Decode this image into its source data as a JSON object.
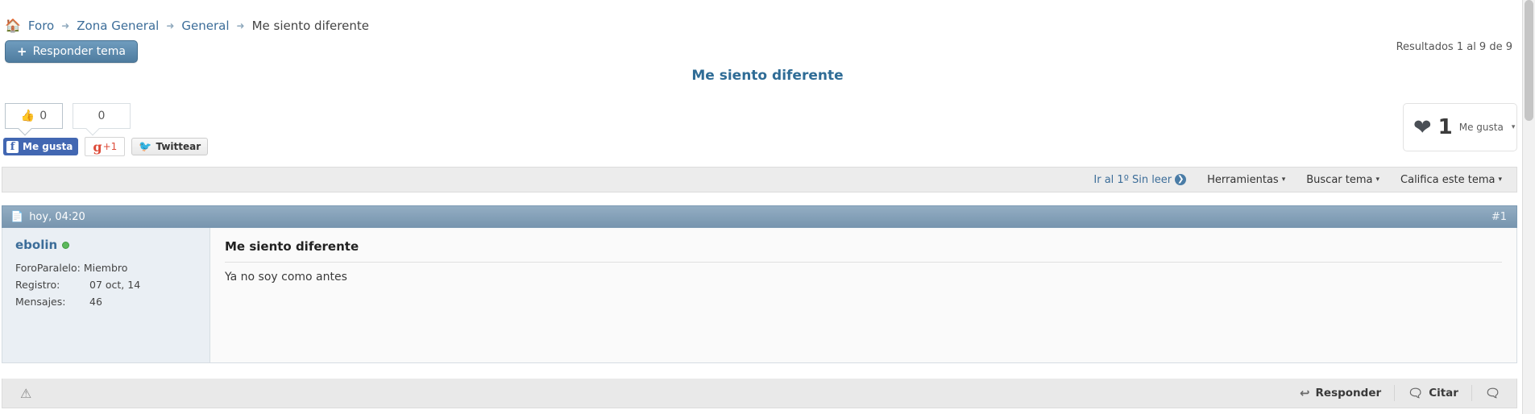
{
  "breadcrumb": {
    "home_icon": "home-icon",
    "items": [
      {
        "label": "Foro",
        "type": "link"
      },
      {
        "label": "Zona General",
        "type": "link"
      },
      {
        "label": "General",
        "type": "link"
      },
      {
        "label": "Me siento diferente",
        "type": "current"
      }
    ],
    "separator": "➜"
  },
  "actions": {
    "reply_topic_label": "Responder tema",
    "reply_topic_plus": "+"
  },
  "results_text": "Resultados 1 al 9 de 9",
  "page_title": "Me siento diferente",
  "votes": {
    "thumb_icon": "thumbs-up-icon",
    "thumb_count": "0",
    "second_count": "0"
  },
  "social": {
    "facebook_glyph": "f",
    "facebook_label": "Me gusta",
    "google_g": "g",
    "google_plus": "+1",
    "twitter_bird": "✓",
    "twitter_label": "Twittear"
  },
  "like_box": {
    "heart_icon": "heart-icon",
    "count": "1",
    "label": "Me gusta",
    "caret": "▾"
  },
  "toolbar": {
    "goto_unread": "Ir al 1º Sin leer",
    "unread_badge": "❯",
    "tools": "Herramientas",
    "search_topic": "Buscar tema",
    "rate_topic": "Califica este tema",
    "caret": "▾"
  },
  "post": {
    "doc_icon": "document-icon",
    "date": "hoy, 04:20",
    "number": "#1",
    "user": {
      "name": "ebolin",
      "online_status": "online",
      "membership_label": "ForoParalelo:",
      "membership_value": "Miembro",
      "registro_label": "Registro:",
      "registro_value": "07 oct, 14",
      "mensajes_label": "Mensajes:",
      "mensajes_value": "46"
    },
    "title": "Me siento diferente",
    "text": "Ya no soy como antes"
  },
  "post_footer": {
    "report_icon": "warning-triangle-icon",
    "reply_label": "Responder",
    "reply_icon": "reply-arrow-icon",
    "quote_label": "Citar",
    "quote_icon": "quote-bubble-icon",
    "multiquote_icon": "multi-quote-icon"
  },
  "colors": {
    "link": "#3c6d99",
    "title": "#2f6c96",
    "post_header": "#7795ae",
    "button": "#4f7c9f",
    "online": "#5cb85c",
    "facebook": "#4267b2",
    "google": "#dd4b39",
    "twitter": "#1da1f2"
  }
}
